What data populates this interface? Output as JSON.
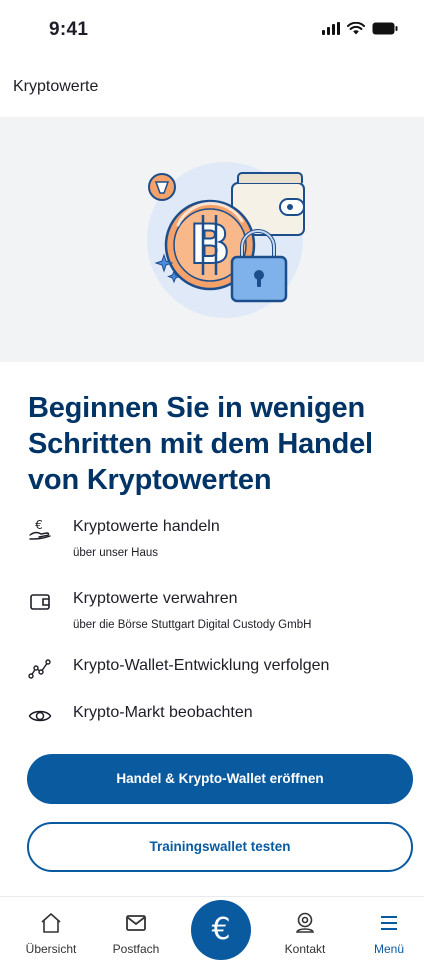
{
  "status_bar": {
    "time": "9:41"
  },
  "header": {
    "title": "Kryptowerte"
  },
  "hero": {
    "illustration": "bitcoin-wallet-lock-illustration"
  },
  "headline": "Beginnen Sie in wenigen Schritten mit dem Handel von Kryptowerten",
  "features": [
    {
      "icon": "hand-euro-icon",
      "title": "Kryptowerte handeln",
      "subtitle": "über unser Haus"
    },
    {
      "icon": "wallet-icon",
      "title": "Kryptowerte verwahren",
      "subtitle": "über die Börse Stuttgart Digital Custody GmbH"
    },
    {
      "icon": "chart-line-icon",
      "title": "Krypto-Wallet-Entwicklung verfolgen"
    },
    {
      "icon": "eye-icon",
      "title": "Krypto-Markt beobachten"
    }
  ],
  "actions": {
    "primary_label": "Handel & Krypto-Wallet eröffnen",
    "secondary_label": "Trainingswallet testen"
  },
  "bottom_nav": {
    "items": [
      {
        "label": "Übersicht",
        "icon": "home-icon"
      },
      {
        "label": "Postfach",
        "icon": "mail-icon"
      },
      {
        "label": "€",
        "icon": "euro-icon"
      },
      {
        "label": "Kontakt",
        "icon": "contact-icon"
      },
      {
        "label": "Menü",
        "icon": "menu-icon",
        "active": true
      }
    ]
  },
  "colors": {
    "brand_dark": "#003366",
    "brand_primary": "#0a5aa0",
    "hero_background": "#f2f3f5",
    "accent_orange": "#f5a26a"
  }
}
